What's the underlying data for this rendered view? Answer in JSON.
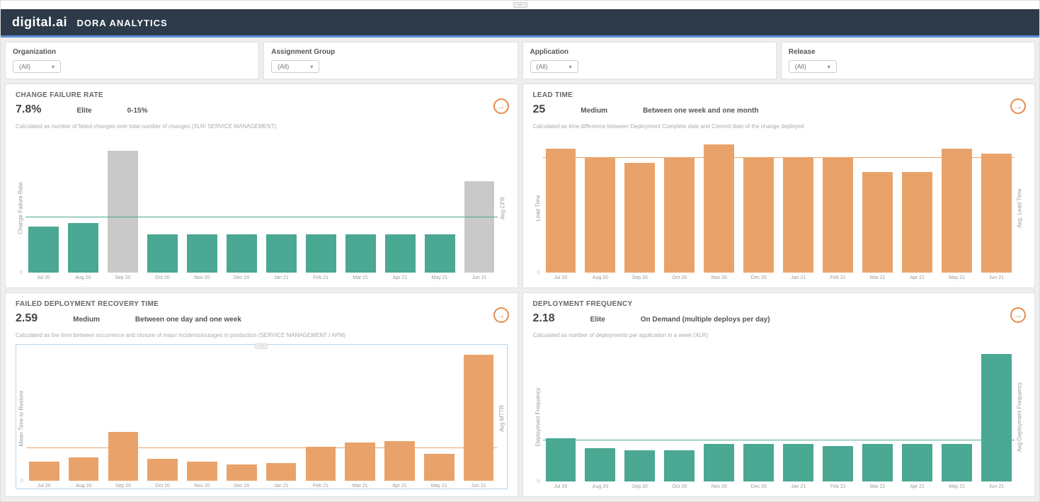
{
  "header": {
    "brand": "digital.ai",
    "title": "DORA ANALYTICS"
  },
  "top_handle_label": "—",
  "filters": [
    {
      "label": "Organization",
      "value": "(All)"
    },
    {
      "label": "Assignment Group",
      "value": "(All)"
    },
    {
      "label": "Application",
      "value": "(All)"
    },
    {
      "label": "Release",
      "value": "(All)"
    }
  ],
  "panels": {
    "cfr": {
      "title": "CHANGE FAILURE RATE",
      "value": "7.8%",
      "tier": "Elite",
      "range": "0-15%",
      "desc": "Calculated as number of failed changes over total number of changes (XLR/ SERVICE MANAGEMENT)",
      "ylabel_left": "Change Failure Rate",
      "ylabel_right": "Avg CFR"
    },
    "lead": {
      "title": "LEAD TIME",
      "value": "25",
      "tier": "Medium",
      "range": "Between one week and one month",
      "desc": "Calculated as time difference between Deployment Complete date and Commit date of the change deployed",
      "ylabel_left": "Lead Time",
      "ylabel_right": "Avg. Lead Time"
    },
    "fdrt": {
      "title": "FAILED DEPLOYMENT RECOVERY TIME",
      "value": "2.59",
      "tier": "Medium",
      "range": "Between one day and one week",
      "desc": "Calculated as the time between occurrence and closure of major incidents/outages in production (SERVICE MANAGEMENT / APM)",
      "ylabel_left": "Mean Time to Restore",
      "ylabel_right": "Avg MTTR"
    },
    "df": {
      "title": "DEPLOYMENT FREQUENCY",
      "value": "2.18",
      "tier": "Elite",
      "range": "On Demand (multiple deploys per day)",
      "desc": "Calculated as number of deployments per application in a week (XLR)",
      "ylabel_left": "Deployment Frequency",
      "ylabel_right": "Avg Deployment Frequency"
    }
  },
  "colors": {
    "green": "#4aa893",
    "orange": "#e9a36a",
    "grey": "#c9c9c9",
    "line_green": "#4aa893",
    "line_orange": "#e9a36a"
  },
  "chart_data": [
    {
      "id": "cfr",
      "type": "bar",
      "title": "Change Failure Rate",
      "xlabel": "",
      "ylabel": "Change Failure Rate",
      "categories": [
        "Jul 20",
        "Aug 20",
        "Sep 20",
        "Oct 20",
        "Nov 20",
        "Dec 20",
        "Jan 21",
        "Feb 21",
        "Mar 21",
        "Apr 21",
        "May 21",
        "Jun 21"
      ],
      "values": [
        6,
        6.5,
        16,
        5,
        5,
        5,
        5,
        5,
        5,
        5,
        5,
        12
      ],
      "bar_colors": [
        "green",
        "green",
        "grey",
        "green",
        "green",
        "green",
        "green",
        "green",
        "green",
        "green",
        "green",
        "grey"
      ],
      "avg_line": 7.2,
      "avg_line_color": "line_green",
      "ylim": [
        0,
        18
      ]
    },
    {
      "id": "lead",
      "type": "bar",
      "title": "Lead Time",
      "xlabel": "",
      "ylabel": "Lead Time",
      "categories": [
        "Jul 20",
        "Aug 20",
        "Sep 20",
        "Oct 20",
        "Nov 20",
        "Dec 20",
        "Jan 21",
        "Feb 21",
        "Mar 21",
        "Apr 21",
        "May 21",
        "Jun 21"
      ],
      "values": [
        27,
        25,
        24,
        25,
        28,
        25,
        25,
        25,
        22,
        22,
        27,
        26
      ],
      "bar_colors": [
        "orange",
        "orange",
        "orange",
        "orange",
        "orange",
        "orange",
        "orange",
        "orange",
        "orange",
        "orange",
        "orange",
        "orange"
      ],
      "avg_line": 25,
      "avg_line_color": "line_orange",
      "ylim": [
        0,
        30
      ]
    },
    {
      "id": "fdrt",
      "type": "bar",
      "title": "Failed Deployment Recovery Time",
      "xlabel": "",
      "ylabel": "Mean Time to Restore",
      "categories": [
        "Jul 20",
        "Aug 20",
        "Sep 20",
        "Oct 20",
        "Nov 20",
        "Dec 20",
        "Jan 21",
        "Feb 21",
        "Mar 21",
        "Apr 21",
        "May 21",
        "Jun 21"
      ],
      "values": [
        1.3,
        1.6,
        3.3,
        1.5,
        1.3,
        1.1,
        1.2,
        2.3,
        2.6,
        2.7,
        1.8,
        8.5
      ],
      "bar_colors": [
        "orange",
        "orange",
        "orange",
        "orange",
        "orange",
        "orange",
        "orange",
        "orange",
        "orange",
        "orange",
        "orange",
        "orange"
      ],
      "avg_line": 2.2,
      "avg_line_color": "line_orange",
      "ylim": [
        0,
        9
      ]
    },
    {
      "id": "df",
      "type": "bar",
      "title": "Deployment Frequency",
      "xlabel": "",
      "ylabel": "Deployment Frequency",
      "categories": [
        "Jul 20",
        "Aug 20",
        "Sep 20",
        "Oct 20",
        "Nov 20",
        "Dec 20",
        "Jan 21",
        "Feb 21",
        "Mar 21",
        "Apr 21",
        "May 21",
        "Jun 21"
      ],
      "values": [
        2.2,
        1.7,
        1.6,
        1.6,
        1.9,
        1.9,
        1.9,
        1.8,
        1.9,
        1.9,
        1.9,
        6.5
      ],
      "bar_colors": [
        "green",
        "green",
        "green",
        "green",
        "green",
        "green",
        "green",
        "green",
        "green",
        "green",
        "green",
        "green"
      ],
      "avg_line": 2.1,
      "avg_line_color": "line_green",
      "ylim": [
        0,
        7
      ]
    }
  ]
}
